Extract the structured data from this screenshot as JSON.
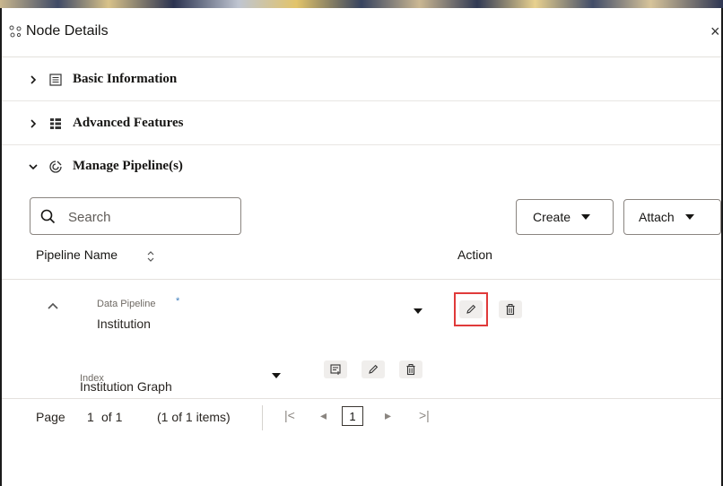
{
  "header": {
    "title": "Node Details",
    "close_label": "×"
  },
  "sections": [
    {
      "label": "Basic Information",
      "expanded": false
    },
    {
      "label": "Advanced Features",
      "expanded": false
    },
    {
      "label": "Manage Pipeline(s)",
      "expanded": true
    }
  ],
  "toolbar": {
    "search_placeholder": "Search",
    "create_label": "Create",
    "attach_label": "Attach"
  },
  "table": {
    "columns": [
      "Pipeline Name",
      "Action"
    ],
    "row": {
      "pipeline_label": "Data Pipeline",
      "required_mark": "*",
      "pipeline_value": "Institution",
      "index_label": "Index",
      "index_value": "Institution Graph"
    }
  },
  "pagination": {
    "page_label": "Page",
    "current_page": "1",
    "of_label": "of 1",
    "items_summary": "(1 of 1 items)",
    "first_icon": "|<",
    "prev_icon": "◂",
    "next_icon": "▸",
    "last_icon": ">|"
  },
  "colors": {
    "highlight": "#e03a3a",
    "text": "#161513",
    "border": "#8a8580"
  }
}
